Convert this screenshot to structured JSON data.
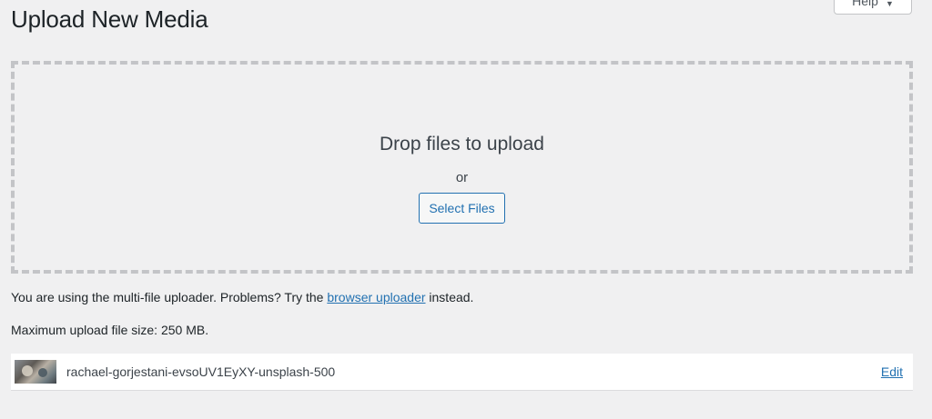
{
  "page": {
    "title": "Upload New Media"
  },
  "help_tab": {
    "label": "Help",
    "caret": "▼"
  },
  "drop_zone": {
    "heading": "Drop files to upload",
    "or_text": "or",
    "select_button": "Select Files"
  },
  "uploader_info": {
    "prefix": "You are using the multi-file uploader. Problems? Try the",
    "link_text": "browser uploader",
    "suffix": "instead."
  },
  "max_upload": {
    "text": "Maximum upload file size: 250 MB."
  },
  "media_items": [
    {
      "filename": "rachael-gorjestani-evsoUV1EyXY-unsplash-500",
      "action": "Edit"
    }
  ]
}
